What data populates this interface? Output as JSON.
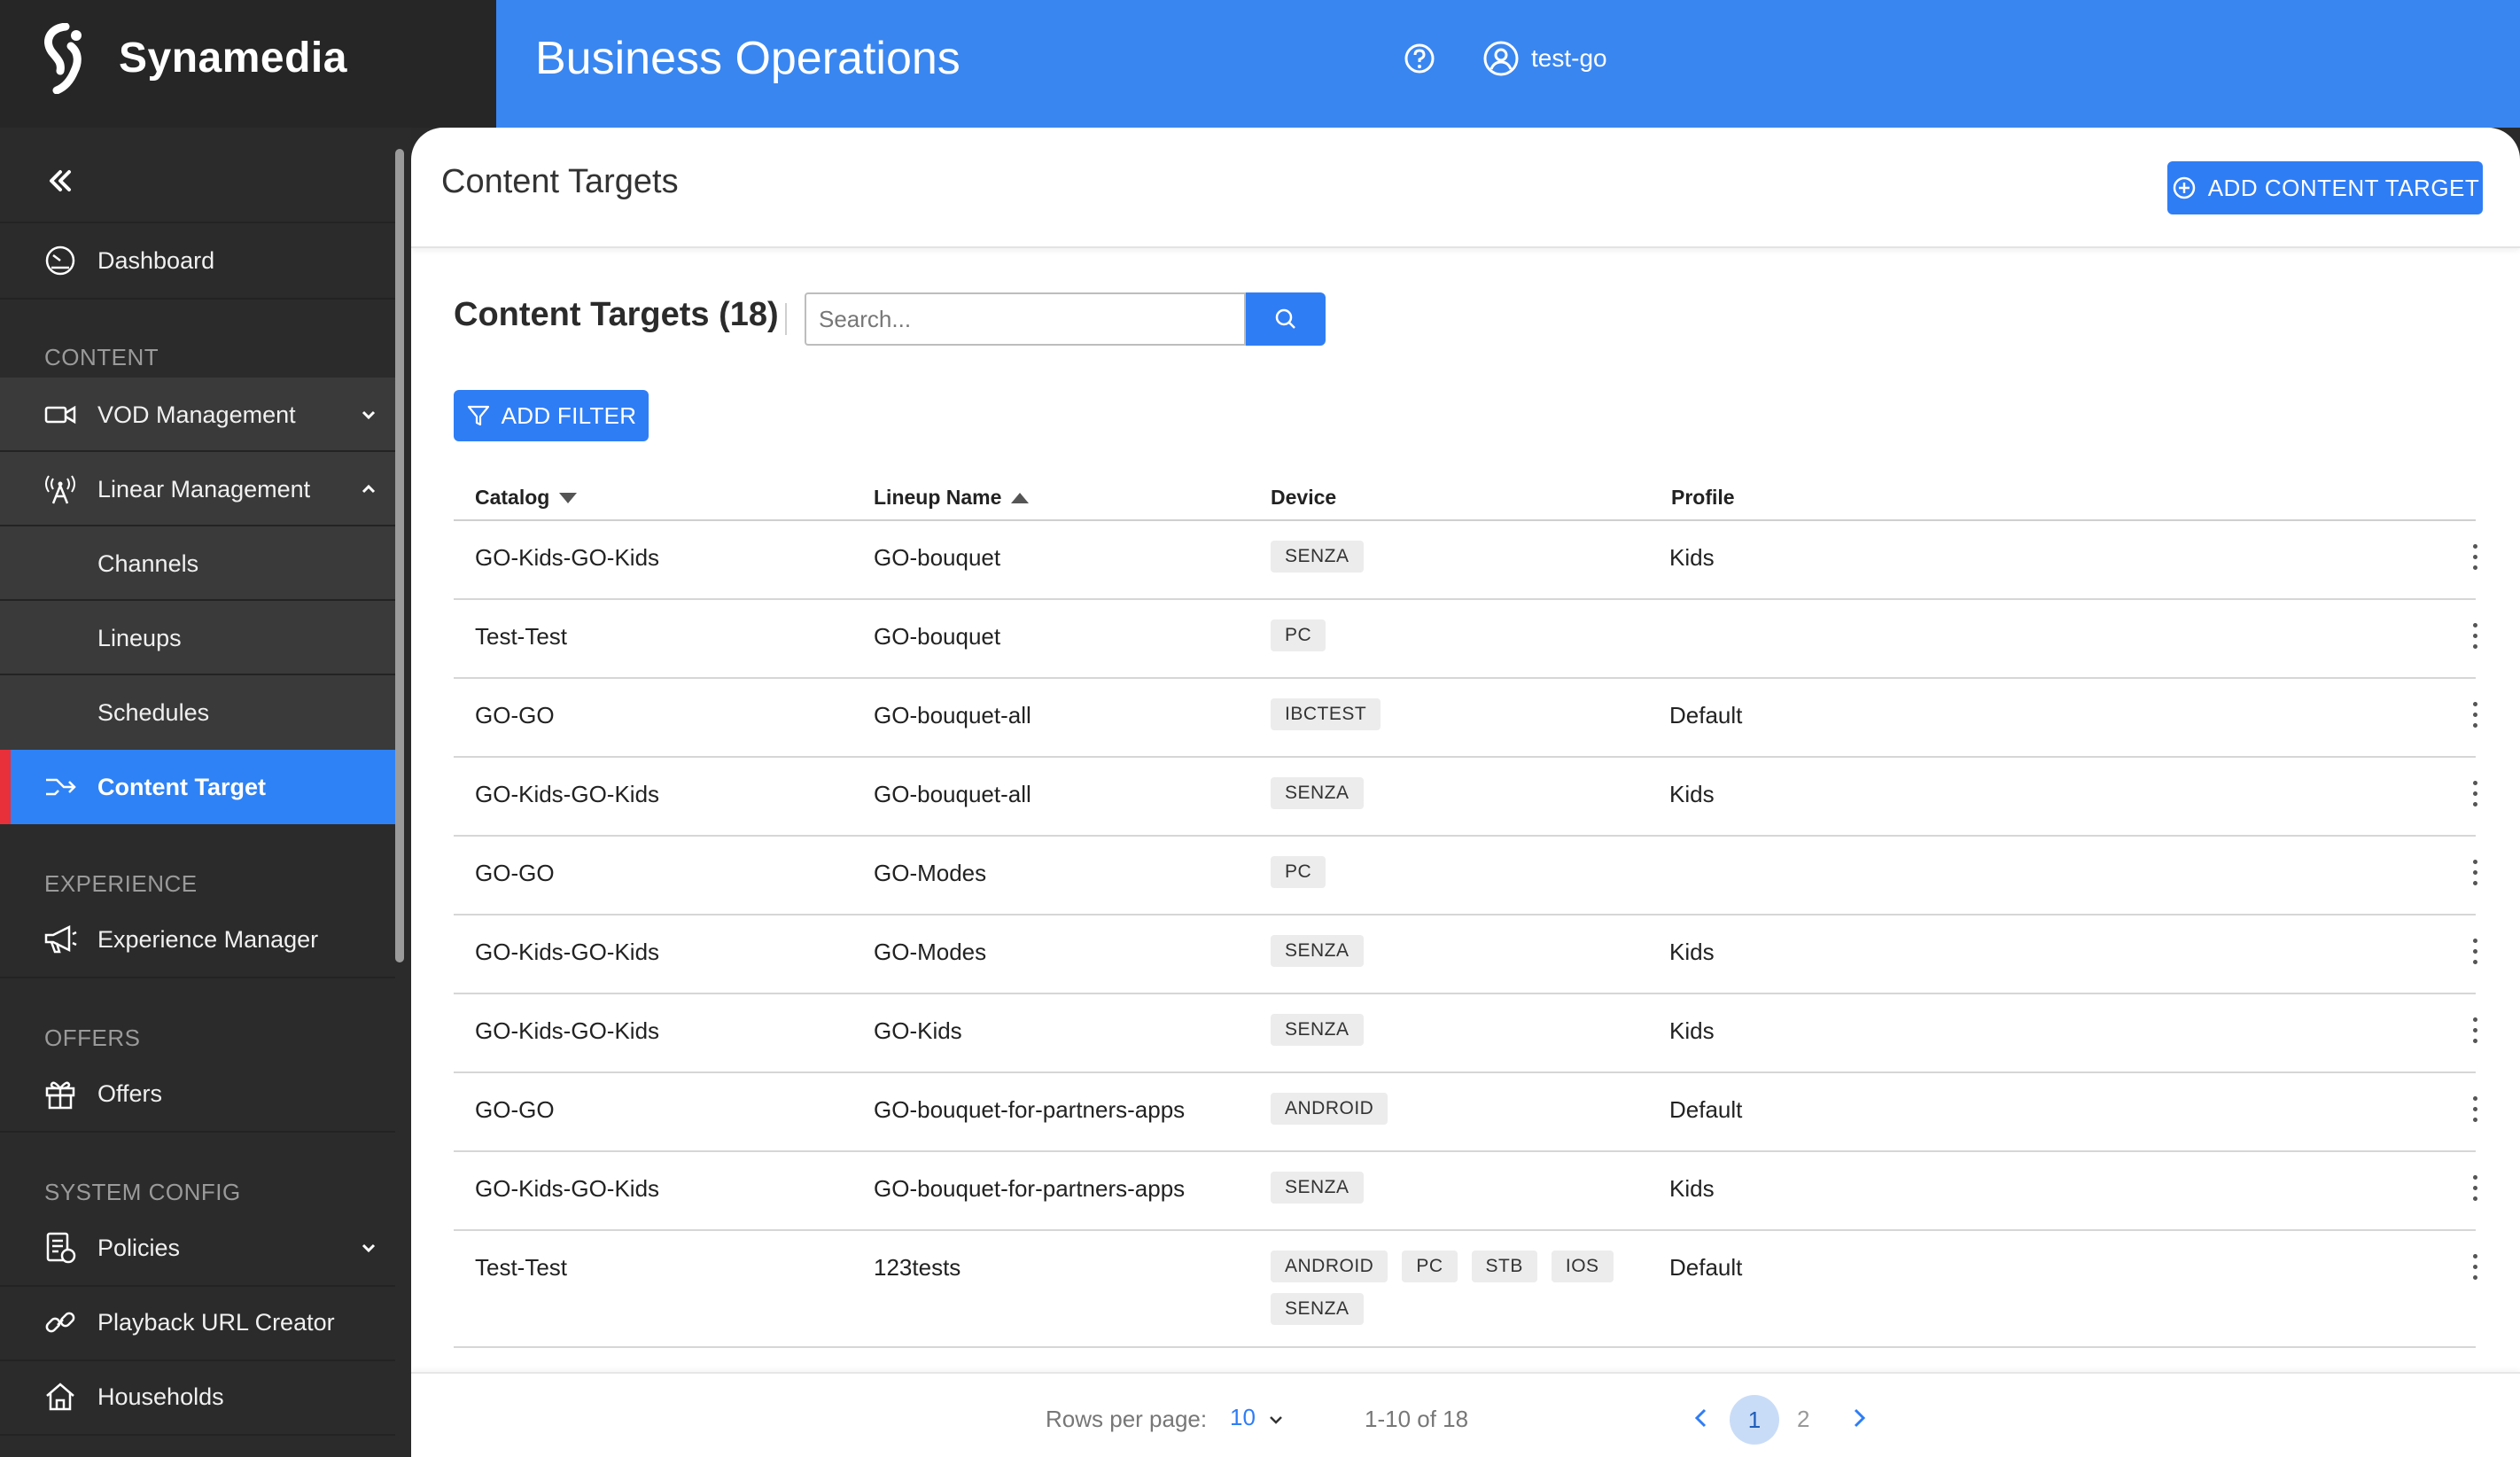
{
  "brand": {
    "name": "Synamedia"
  },
  "header": {
    "title": "Business Operations",
    "user": "test-go"
  },
  "sidebar": {
    "dashboard": "Dashboard",
    "sections": {
      "content": "CONTENT",
      "experience": "EXPERIENCE",
      "offers": "OFFERS",
      "system_config": "SYSTEM CONFIG"
    },
    "items": {
      "vod": "VOD Management",
      "linear": "Linear Management",
      "channels": "Channels",
      "lineups": "Lineups",
      "schedules": "Schedules",
      "content_target": "Content Target",
      "experience_manager": "Experience Manager",
      "offers": "Offers",
      "policies": "Policies",
      "playback_url": "Playback URL Creator",
      "households": "Households"
    },
    "active": "Content Target"
  },
  "page": {
    "title": "Content Targets",
    "add_button": "ADD CONTENT TARGET",
    "list_title": "Content Targets (18)",
    "search_placeholder": "Search...",
    "filter_button": "ADD FILTER"
  },
  "table": {
    "columns": [
      "Catalog",
      "Lineup Name",
      "Device",
      "Profile"
    ],
    "sort": {
      "Catalog": "desc",
      "Lineup Name": "asc"
    },
    "rows": [
      {
        "catalog": "GO-Kids-GO-Kids",
        "lineup": "GO-bouquet",
        "devices": [
          "SENZA"
        ],
        "profile": "Kids"
      },
      {
        "catalog": "Test-Test",
        "lineup": "GO-bouquet",
        "devices": [
          "PC"
        ],
        "profile": ""
      },
      {
        "catalog": "GO-GO",
        "lineup": "GO-bouquet-all",
        "devices": [
          "IBCTEST"
        ],
        "profile": "Default"
      },
      {
        "catalog": "GO-Kids-GO-Kids",
        "lineup": "GO-bouquet-all",
        "devices": [
          "SENZA"
        ],
        "profile": "Kids"
      },
      {
        "catalog": "GO-GO",
        "lineup": "GO-Modes",
        "devices": [
          "PC"
        ],
        "profile": ""
      },
      {
        "catalog": "GO-Kids-GO-Kids",
        "lineup": "GO-Modes",
        "devices": [
          "SENZA"
        ],
        "profile": "Kids"
      },
      {
        "catalog": "GO-Kids-GO-Kids",
        "lineup": "GO-Kids",
        "devices": [
          "SENZA"
        ],
        "profile": "Kids"
      },
      {
        "catalog": "GO-GO",
        "lineup": "GO-bouquet-for-partners-apps",
        "devices": [
          "ANDROID"
        ],
        "profile": "Default"
      },
      {
        "catalog": "GO-Kids-GO-Kids",
        "lineup": "GO-bouquet-for-partners-apps",
        "devices": [
          "SENZA"
        ],
        "profile": "Kids"
      },
      {
        "catalog": "Test-Test",
        "lineup": "123tests",
        "devices": [
          "ANDROID",
          "PC",
          "STB",
          "IOS",
          "SENZA"
        ],
        "profile": "Default"
      }
    ]
  },
  "pagination": {
    "rows_label": "Rows per page:",
    "rows_value": "10",
    "range": "1-10 of 18",
    "pages": [
      "1",
      "2"
    ],
    "current": "1"
  },
  "colors": {
    "primary": "#2f7df5",
    "header": "#3a86f0",
    "sidebar": "#2b2b2b",
    "active_marker": "#e8303a"
  }
}
